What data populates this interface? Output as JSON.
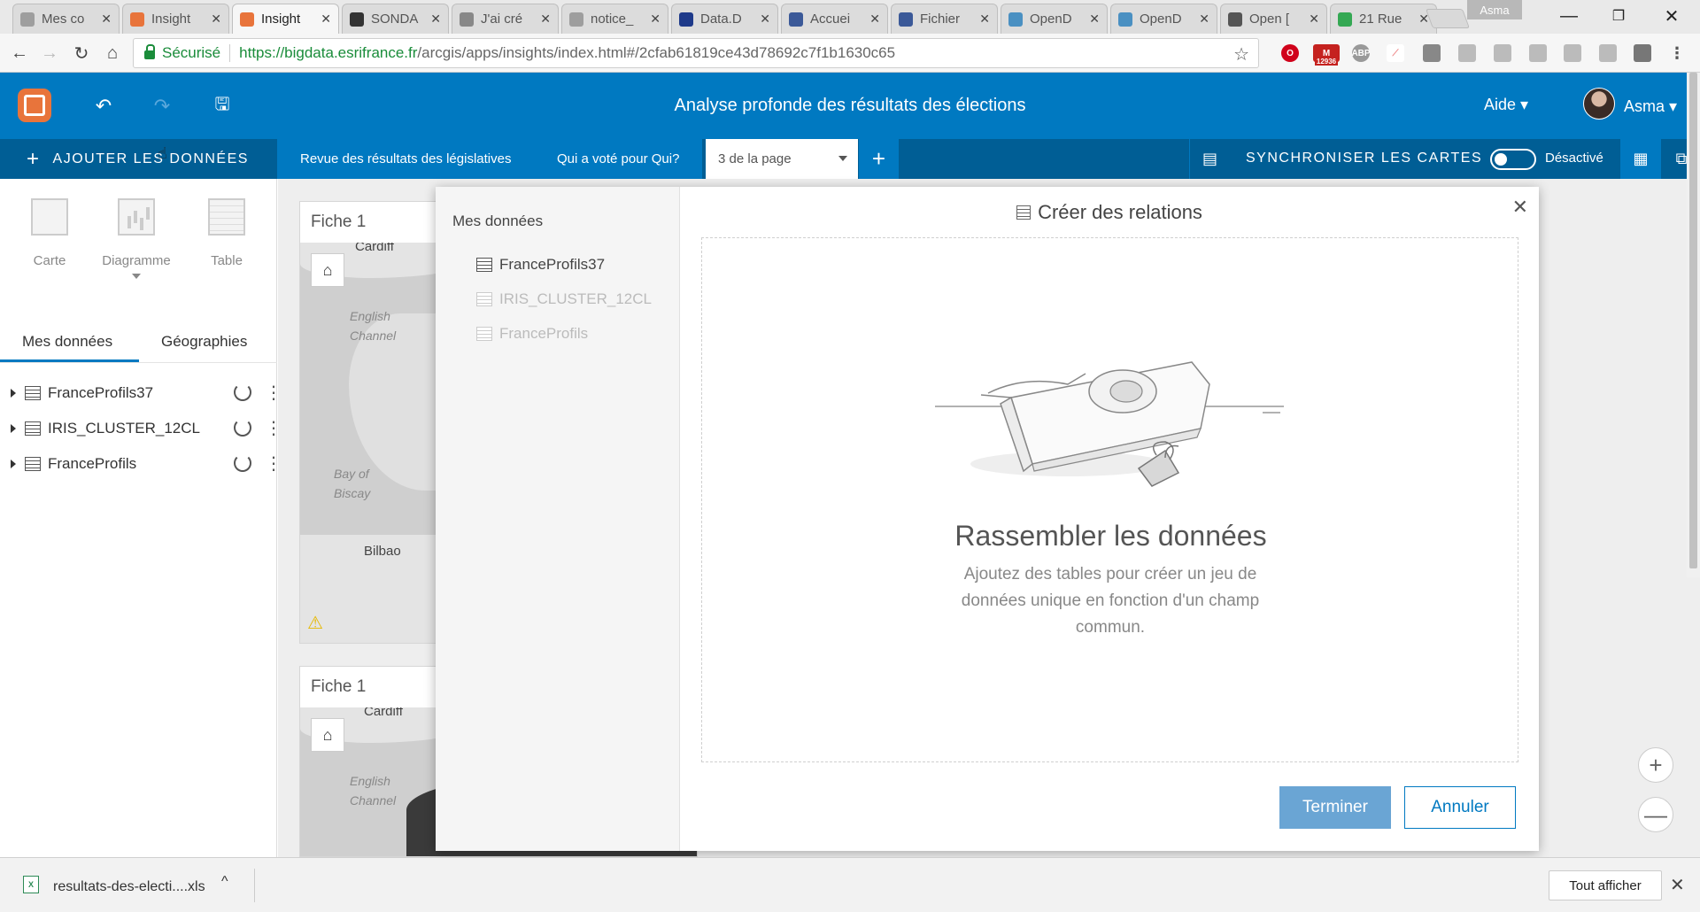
{
  "browser": {
    "tabs": [
      {
        "label": "Mes co",
        "fav_color": "#9e9e9e"
      },
      {
        "label": "Insight",
        "fav_color": "#e8743b"
      },
      {
        "label": "Insight",
        "fav_color": "#e8743b",
        "active": true
      },
      {
        "label": "SONDA",
        "fav_color": "#333333"
      },
      {
        "label": "J'ai cré",
        "fav_color": "#888888"
      },
      {
        "label": "notice_",
        "fav_color": "#9e9e9e"
      },
      {
        "label": "Data.D",
        "fav_color": "#1e3a8a"
      },
      {
        "label": "Accuei",
        "fav_color": "#3b5998"
      },
      {
        "label": "Fichier",
        "fav_color": "#3b5998"
      },
      {
        "label": "OpenD",
        "fav_color": "#4a90c2"
      },
      {
        "label": "OpenD",
        "fav_color": "#4a90c2"
      },
      {
        "label": "Open [",
        "fav_color": "#555555"
      },
      {
        "label": "21 Rue",
        "fav_color": "#34a853"
      }
    ],
    "tab_close": "✕",
    "profile_name": "Asma",
    "window_controls": {
      "minimize": "—",
      "restore": "❐",
      "close": "✕"
    },
    "nav": {
      "back": "←",
      "forward": "→",
      "reload": "↻",
      "home": "⌂"
    },
    "secure_label": "Sécurisé",
    "url_host": "https://bigdata.esrifrance.fr",
    "url_path": "/arcgis/apps/insights/index.html#/2cfab61819ce43d78692c7f1b1630c65",
    "star": "☆",
    "gmail_count": "12936"
  },
  "app": {
    "title": "Analyse profonde des résultats des élections",
    "help_label": "Aide ▾",
    "user_name": "Asma ▾",
    "undo": "↶",
    "redo": "↷",
    "save": "🖫"
  },
  "toolbar": {
    "add_data_label": "AJOUTER LES DONNÉES",
    "add_plus": "+",
    "pages": [
      {
        "label": "Revue des résultats des législatives"
      },
      {
        "label": "Qui a voté pour Qui?"
      }
    ],
    "page_selector": "3 de la page",
    "add_page": "+",
    "sync_label": "SYNCHRONISER LES CARTES",
    "toggle_state": "Désactivé",
    "accent": "#0079c1",
    "dark_accent": "#005e95"
  },
  "left_panel": {
    "viz_options": [
      {
        "label": "Carte",
        "icon": "map-icon"
      },
      {
        "label": "Diagramme",
        "icon": "chart-icon"
      },
      {
        "label": "Table",
        "icon": "table-icon"
      }
    ],
    "tabs": {
      "my_data": "Mes données",
      "geographies": "Géographies"
    },
    "datasets": [
      {
        "name": "FranceProfils37"
      },
      {
        "name": "IRIS_CLUSTER_12CL"
      },
      {
        "name": "FranceProfils"
      }
    ]
  },
  "canvas": {
    "card1": {
      "title": "Fiche 1",
      "labels": {
        "cardiff": "Cardiff",
        "channel": "English\nChannel",
        "biscay": "Bay of\nBiscay",
        "bilbao": "Bilbao"
      }
    },
    "card2": {
      "title": "Fiche 1",
      "labels": {
        "cardiff": "Cardiff",
        "channel": "English\nChannel"
      }
    },
    "home_icon": "⌂",
    "warn_icon": "⚠",
    "zoom_in": "+",
    "zoom_out": "—"
  },
  "modal": {
    "sidebar_title": "Mes données",
    "tables": [
      {
        "name": "FranceProfils37",
        "enabled": true
      },
      {
        "name": "IRIS_CLUSTER_12CL",
        "enabled": false
      },
      {
        "name": "FranceProfils",
        "enabled": false
      }
    ],
    "heading": "Créer des relations",
    "close": "✕",
    "empty_title": "Rassembler les données",
    "empty_desc": "Ajoutez des tables pour créer un jeu de données unique en fonction d'un champ commun.",
    "finish_label": "Terminer",
    "cancel_label": "Annuler"
  },
  "downloads": {
    "file_name": "resultats-des-electi....xls",
    "caret": "^",
    "show_all": "Tout afficher",
    "close": "✕"
  }
}
